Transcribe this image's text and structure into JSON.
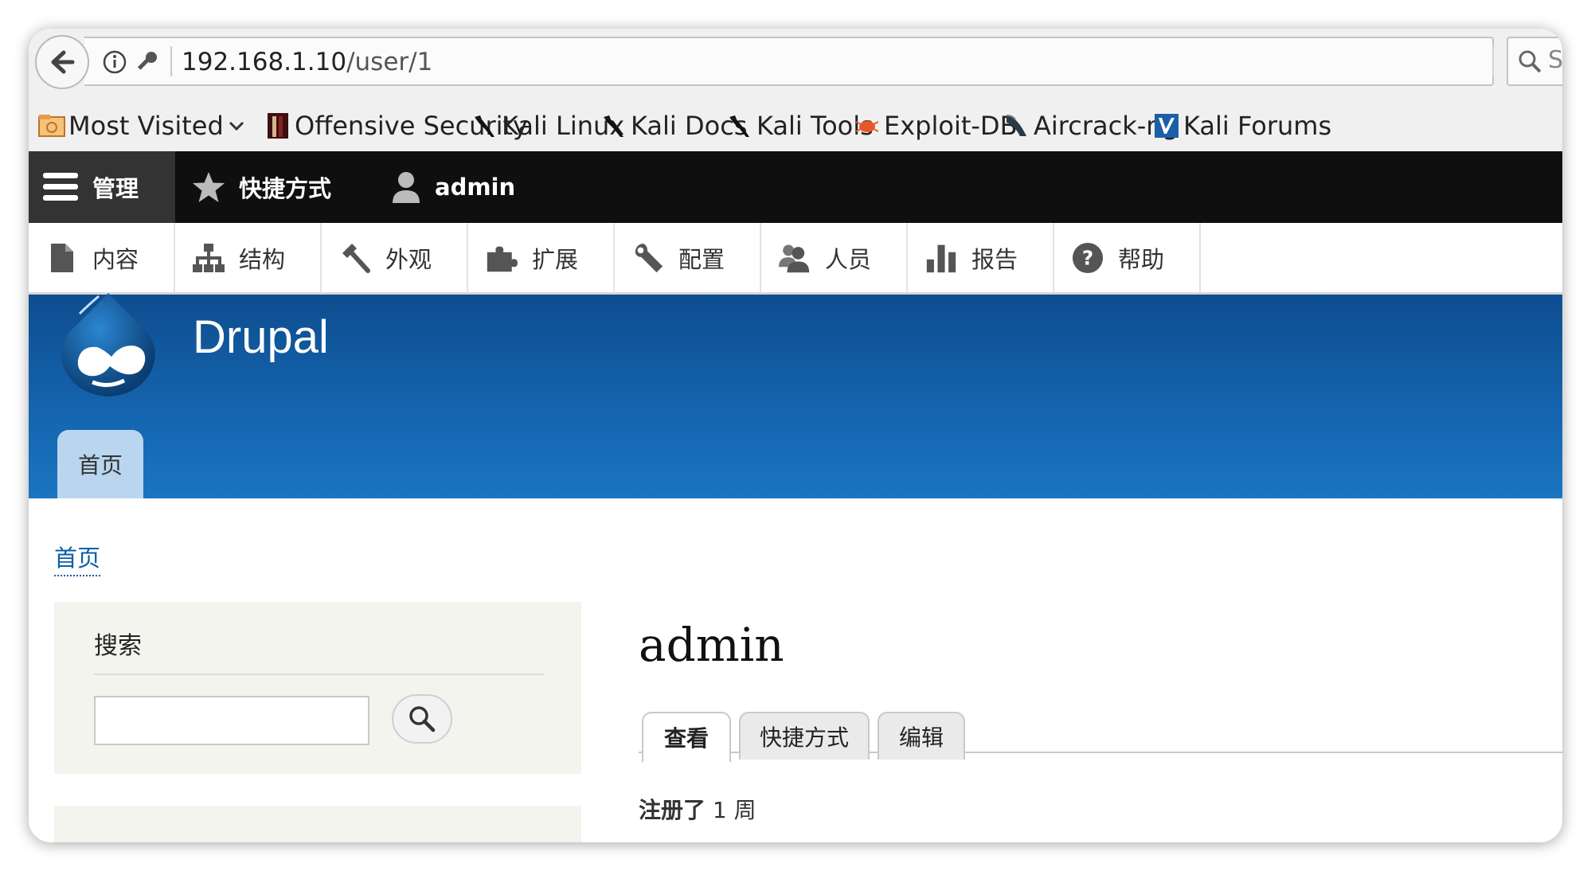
{
  "browser": {
    "url_host": "192.168.1.10",
    "url_path": "/user/1",
    "search_partial": "S",
    "bookmarks": [
      {
        "label": "Most Visited",
        "icon": "folder-icon"
      },
      {
        "label": "Offensive Security",
        "icon": "offsec-icon"
      },
      {
        "label": "Kali Linux",
        "icon": "kali-dragon-icon"
      },
      {
        "label": "Kali Docs",
        "icon": "kali-dragon-icon"
      },
      {
        "label": "Kali Tools",
        "icon": "kali-dragon-icon"
      },
      {
        "label": "Exploit-DB",
        "icon": "exploitdb-icon"
      },
      {
        "label": "Aircrack-ng",
        "icon": "aircrack-icon"
      },
      {
        "label": "Kali Forums",
        "icon": "kali-forums-icon"
      }
    ]
  },
  "admin_toolbar": {
    "manage": "管理",
    "shortcuts": "快捷方式",
    "user": "admin",
    "tray": [
      {
        "label": "内容",
        "icon": "content-icon"
      },
      {
        "label": "结构",
        "icon": "structure-icon"
      },
      {
        "label": "外观",
        "icon": "appearance-icon"
      },
      {
        "label": "扩展",
        "icon": "extend-icon"
      },
      {
        "label": "配置",
        "icon": "config-icon"
      },
      {
        "label": "人员",
        "icon": "people-icon"
      },
      {
        "label": "报告",
        "icon": "reports-icon"
      },
      {
        "label": "帮助",
        "icon": "help-icon"
      }
    ]
  },
  "site": {
    "name": "Drupal",
    "home_tab": "首页"
  },
  "main": {
    "breadcrumb": "首页",
    "search_block_title": "搜索",
    "page_title": "admin",
    "tabs": [
      "查看",
      "快捷方式",
      "编辑"
    ],
    "member_for_label": "注册了",
    "member_for_value": "1 周"
  },
  "colors": {
    "header_blue": "#1566b0",
    "toolbar_dark": "#0f0f0f",
    "link_blue": "#0b5fa5"
  }
}
